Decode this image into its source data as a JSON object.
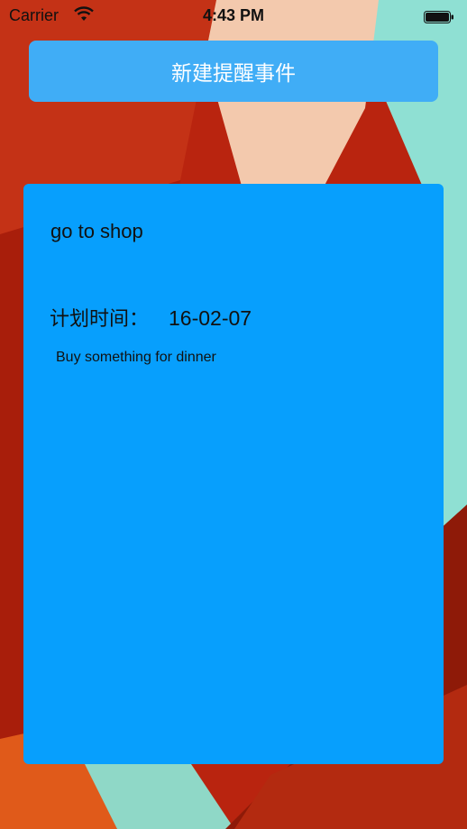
{
  "status_bar": {
    "carrier": "Carrier",
    "time": "4:43 PM",
    "wifi_icon": "wifi-icon",
    "battery_icon": "battery-icon"
  },
  "new_reminder_button": {
    "label": "新建提醒事件",
    "color": "#40adf6"
  },
  "reminder": {
    "title": "go to shop",
    "time_label": "计划时间：",
    "time_value": "16-02-07",
    "description": "Buy something for dinner",
    "card_color": "#079ffd"
  },
  "colors": {
    "bg_red": "#b9240f",
    "bg_peach": "#f3c9ad",
    "bg_mint": "#8fe0d3"
  }
}
